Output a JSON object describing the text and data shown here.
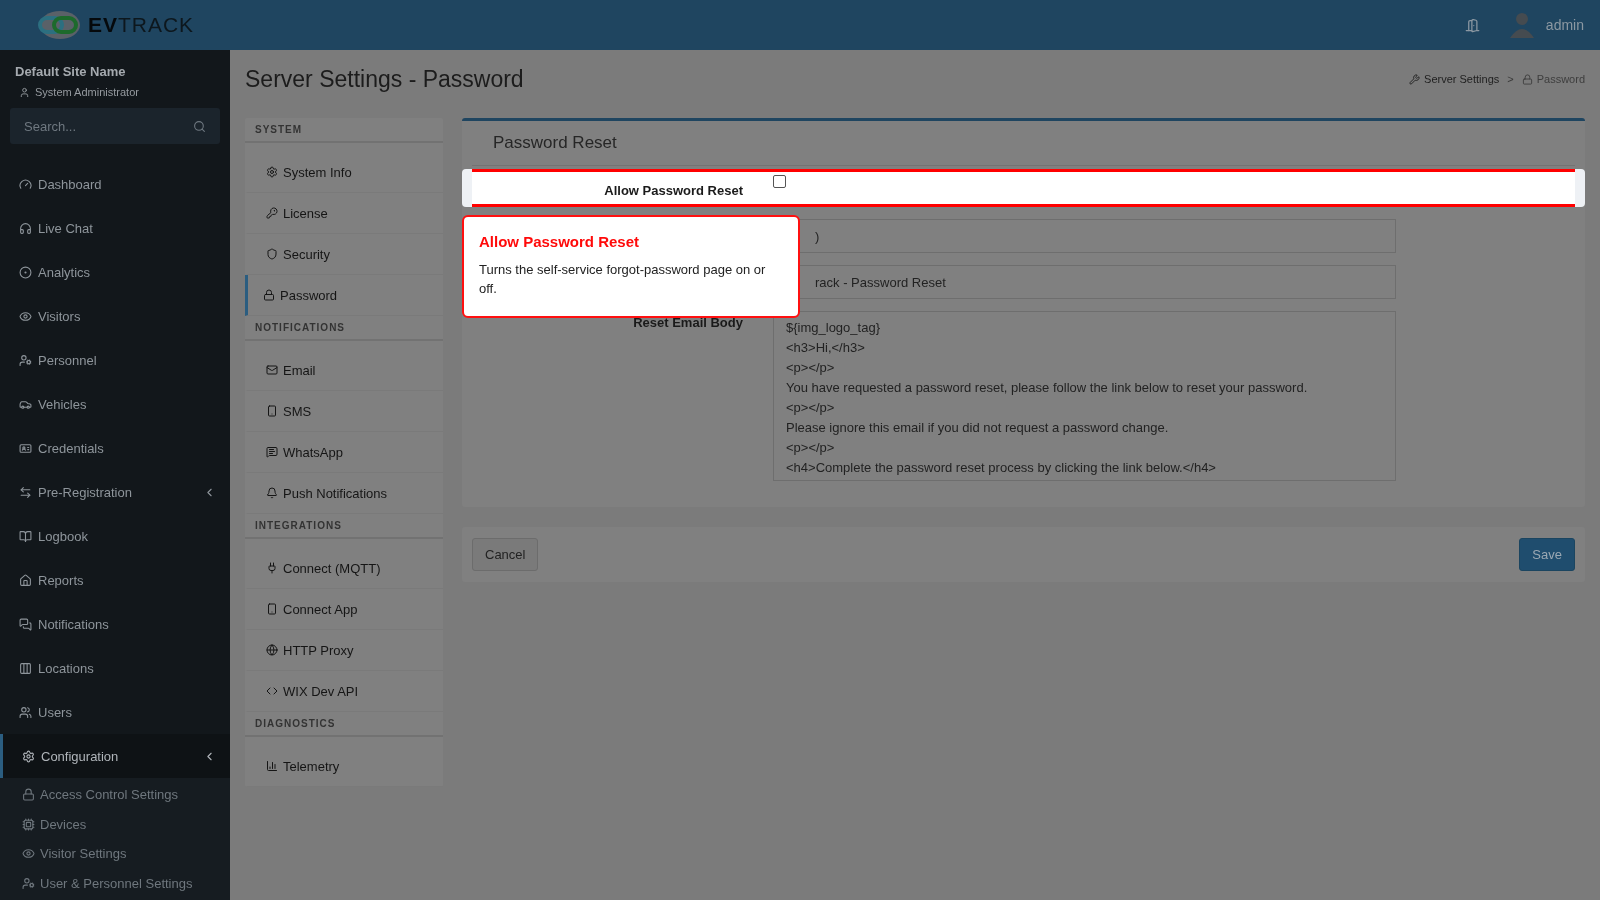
{
  "header": {
    "logo": "**EV**TRACK",
    "user": "admin"
  },
  "sidebar": {
    "site_name": "Default Site Name",
    "role": "System Administrator",
    "search": {
      "placeholder": "Search..."
    },
    "items": [
      {
        "label": "Dashboard",
        "selected": false
      },
      {
        "label": "Live Chat",
        "selected": false
      },
      {
        "label": "Analytics",
        "selected": false
      },
      {
        "label": "Visitors",
        "selected": false
      },
      {
        "label": "Personnel",
        "selected": false
      },
      {
        "label": "Vehicles",
        "selected": false
      },
      {
        "label": "Credentials",
        "selected": false
      },
      {
        "label": "Pre-Registration",
        "selected": false,
        "expanded": false
      },
      {
        "label": "Logbook",
        "selected": false
      },
      {
        "label": "Reports",
        "selected": false
      },
      {
        "label": "Notifications",
        "selected": false
      },
      {
        "label": "Locations",
        "selected": false
      },
      {
        "label": "Users",
        "selected": false
      },
      {
        "label": "Configuration",
        "selected": true,
        "expanded": true,
        "children": [
          {
            "label": "Access Control Settings"
          },
          {
            "label": "Devices"
          },
          {
            "label": "Visitor Settings"
          },
          {
            "label": "User & Personnel Settings"
          }
        ]
      }
    ]
  },
  "page": {
    "title": "Server Settings - Password",
    "breadcrumb": [
      {
        "label": "Server Settings"
      },
      {
        "label": "Password"
      }
    ],
    "breadcrumb_separator": ">"
  },
  "settings_nav": [
    {
      "heading": "SYSTEM",
      "items": [
        {
          "label": "System Info",
          "selected": false
        },
        {
          "label": "License",
          "selected": false
        },
        {
          "label": "Security",
          "selected": false
        },
        {
          "label": "Password",
          "selected": true
        }
      ]
    },
    {
      "heading": "NOTIFICATIONS",
      "items": [
        {
          "label": "Email",
          "selected": false
        },
        {
          "label": "SMS",
          "selected": false
        },
        {
          "label": "WhatsApp",
          "selected": false
        },
        {
          "label": "Push Notifications",
          "selected": false
        }
      ]
    },
    {
      "heading": "INTEGRATIONS",
      "items": [
        {
          "label": "Connect (MQTT)",
          "selected": false
        },
        {
          "label": "Connect App",
          "selected": false
        },
        {
          "label": "HTTP Proxy",
          "selected": false
        },
        {
          "label": "WIX Dev API",
          "selected": false
        }
      ]
    },
    {
      "heading": "DIAGNOSTICS",
      "items": [
        {
          "label": "Telemetry",
          "selected": false
        }
      ]
    }
  ],
  "panel": {
    "title": "Password Reset",
    "rows": [
      {
        "kind": "checkbox",
        "label": "Allow Password Reset",
        "checked": false,
        "highlighted": true
      },
      {
        "kind": "input",
        "value": ")"
      },
      {
        "kind": "input",
        "value": "rack - Password Reset"
      },
      {
        "kind": "textarea",
        "label": "Reset Email Body",
        "lines": [
          "${img_logo_tag}",
          "<h3>Hi,</h3>",
          "<p></p>",
          "You have requested a password reset, please follow the link below to reset your password.",
          "<p></p>",
          "Please ignore this email if you did not request a password change.",
          "<p></p>",
          "<h4>Complete the password reset process by clicking the link below.</h4>"
        ]
      }
    ]
  },
  "buttons": [
    {
      "label": "Cancel",
      "kind": "secondary"
    },
    {
      "label": "Save",
      "kind": "primary"
    }
  ],
  "tooltip": {
    "title": "Allow Password Reset",
    "text": "Turns the self-service forgot-password page on or off."
  }
}
